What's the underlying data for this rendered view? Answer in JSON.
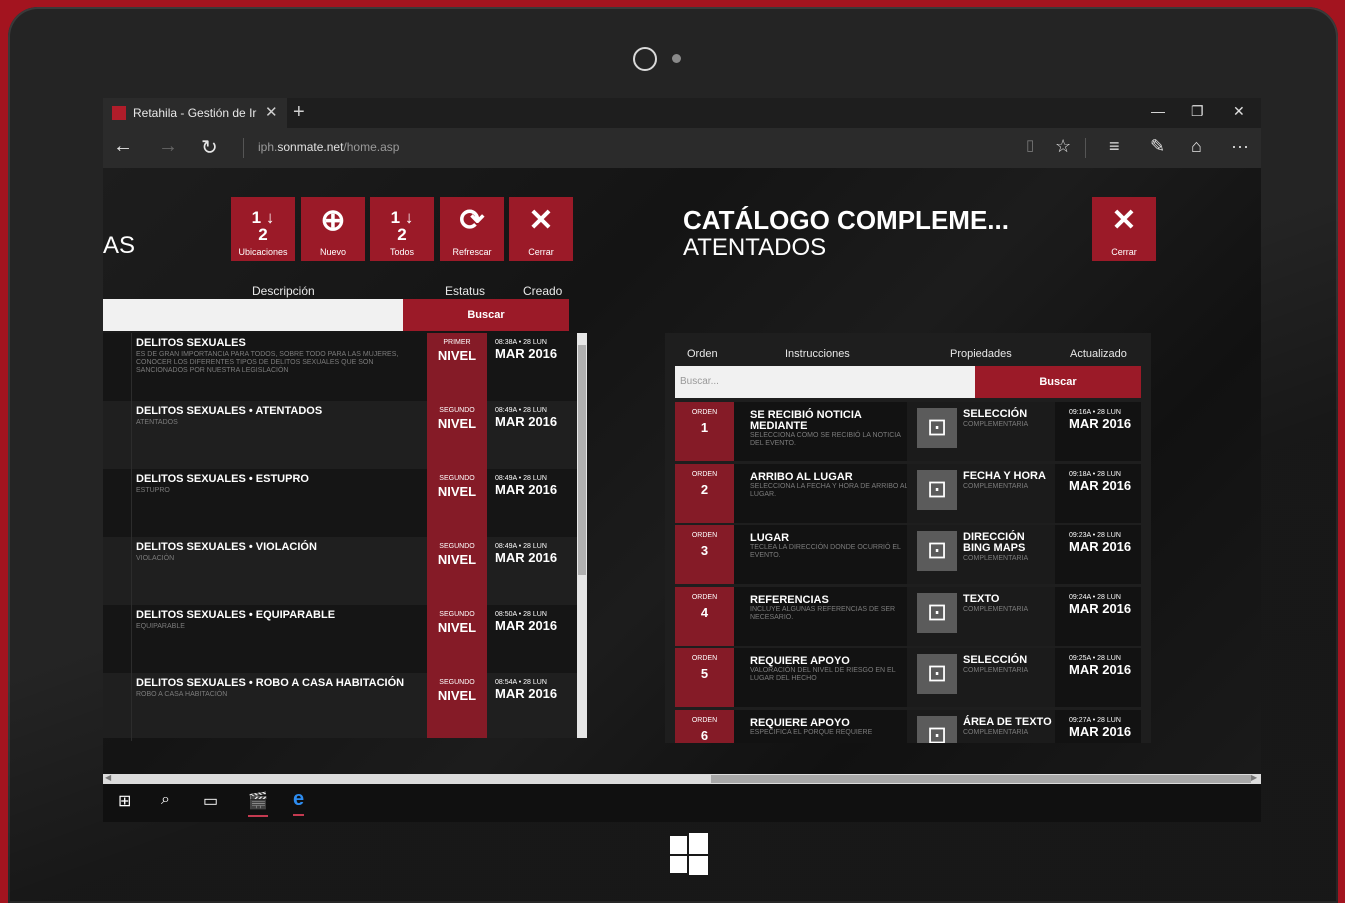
{
  "browser": {
    "tab_title": "Retahila - Gestión de Ir",
    "url_prefix": "iph.",
    "url_domain": "sonmate.net",
    "url_path": "/home.asp"
  },
  "left_panel": {
    "title_partial": "AS",
    "toolbar": [
      {
        "name": "ubicaciones",
        "label": "Ubicaciones",
        "icon": "1 2 ↓"
      },
      {
        "name": "nuevo",
        "label": "Nuevo",
        "icon": "⊕"
      },
      {
        "name": "todos",
        "label": "Todos",
        "icon": "1 2 ↓"
      },
      {
        "name": "refrescar",
        "label": "Refrescar",
        "icon": "⟳"
      },
      {
        "name": "cerrar",
        "label": "Cerrar",
        "icon": "✕"
      }
    ],
    "headers": {
      "descripcion": "Descripción",
      "estatus": "Estatus",
      "creado": "Creado"
    },
    "search_button": "Buscar",
    "rows": [
      {
        "title": "DELITOS SEXUALES",
        "desc": "ES DE GRAN IMPORTANCIA PARA TODOS, SOBRE TODO PARA LAS MUJERES, CONOCER LOS DIFERENTES TIPOS DE DELITOS SEXUALES QUE SON SANCIONADOS POR NUESTRA LEGISLACIÓN",
        "status_top": "PRIMER",
        "status": "NIVEL",
        "created_top": "08:38A • 28 LUN",
        "created": "MAR 2016"
      },
      {
        "title": "DELITOS SEXUALES • ATENTADOS",
        "desc": "ATENTADOS",
        "status_top": "SEGUNDO",
        "status": "NIVEL",
        "created_top": "08:49A • 28 LUN",
        "created": "MAR 2016"
      },
      {
        "title": "DELITOS SEXUALES • ESTUPRO",
        "desc": "ESTUPRO",
        "status_top": "SEGUNDO",
        "status": "NIVEL",
        "created_top": "08:49A • 28 LUN",
        "created": "MAR 2016"
      },
      {
        "title": "DELITOS SEXUALES • VIOLACIÓN",
        "desc": "VIOLACIÓN",
        "status_top": "SEGUNDO",
        "status": "NIVEL",
        "created_top": "08:49A • 28 LUN",
        "created": "MAR 2016"
      },
      {
        "title": "DELITOS SEXUALES • EQUIPARABLE",
        "desc": "EQUIPARABLE",
        "status_top": "SEGUNDO",
        "status": "NIVEL",
        "created_top": "08:50A • 28 LUN",
        "created": "MAR 2016"
      },
      {
        "title": "DELITOS SEXUALES • ROBO A CASA HABITACIÓN",
        "desc": "ROBO A CASA HABITACIÓN",
        "status_top": "SEGUNDO",
        "status": "NIVEL",
        "created_top": "08:54A • 28 LUN",
        "created": "MAR 2016"
      }
    ]
  },
  "right_panel": {
    "title": "CATÁLOGO COMPLEME...",
    "subtitle": "ATENTADOS",
    "close_label": "Cerrar",
    "headers": {
      "orden": "Orden",
      "instrucciones": "Instrucciones",
      "propiedades": "Propiedades",
      "actualizado": "Actualizado"
    },
    "search_placeholder": "Buscar...",
    "search_button": "Buscar",
    "rows": [
      {
        "order_label": "ORDEN",
        "order": "1",
        "title": "SE RECIBIÓ NOTICIA MEDIANTE",
        "desc": "SELECCIONA COMO SE RECIBIÓ LA NOTICIA DEL EVENTO.",
        "prop": "SELECCIÓN",
        "prop_desc": "COMPLEMENTARIA",
        "upd_top": "09:16A • 28 LUN",
        "upd": "MAR 2016"
      },
      {
        "order_label": "ORDEN",
        "order": "2",
        "title": "ARRIBO AL LUGAR",
        "desc": "SELECCIONA LA FECHA Y HORA DE ARRIBO AL LUGAR.",
        "prop": "FECHA Y HORA",
        "prop_desc": "COMPLEMENTARIA",
        "upd_top": "09:18A • 28 LUN",
        "upd": "MAR 2016"
      },
      {
        "order_label": "ORDEN",
        "order": "3",
        "title": "LUGAR",
        "desc": "TECLEA LA DIRECCIÓN DONDE OCURRIÓ EL EVENTO.",
        "prop": "DIRECCIÓN BING MAPS",
        "prop_desc": "COMPLEMENTARIA",
        "upd_top": "09:23A • 28 LUN",
        "upd": "MAR 2016"
      },
      {
        "order_label": "ORDEN",
        "order": "4",
        "title": "REFERENCIAS",
        "desc": "INCLUYE ALGUNAS REFERENCIAS DE SER NECESARIO.",
        "prop": "TEXTO",
        "prop_desc": "COMPLEMENTARIA",
        "upd_top": "09:24A • 28 LUN",
        "upd": "MAR 2016"
      },
      {
        "order_label": "ORDEN",
        "order": "5",
        "title": "REQUIERE APOYO",
        "desc": "VALORACIÓN DEL NIVEL DE RIESGO EN EL LUGAR DEL HECHO",
        "prop": "SELECCIÓN",
        "prop_desc": "COMPLEMENTARIA",
        "upd_top": "09:25A • 28 LUN",
        "upd": "MAR 2016"
      },
      {
        "order_label": "ORDEN",
        "order": "6",
        "title": "REQUIERE APOYO",
        "desc": "ESPECIFICA EL PORQUE REQUIERE",
        "prop": "ÁREA DE TEXTO",
        "prop_desc": "COMPLEMENTARIA",
        "upd_top": "09:27A • 28 LUN",
        "upd": "MAR 2016"
      }
    ]
  },
  "colors": {
    "accent": "#9b1a28",
    "accent_dark": "#851b27",
    "bezel": "#a3141f"
  }
}
